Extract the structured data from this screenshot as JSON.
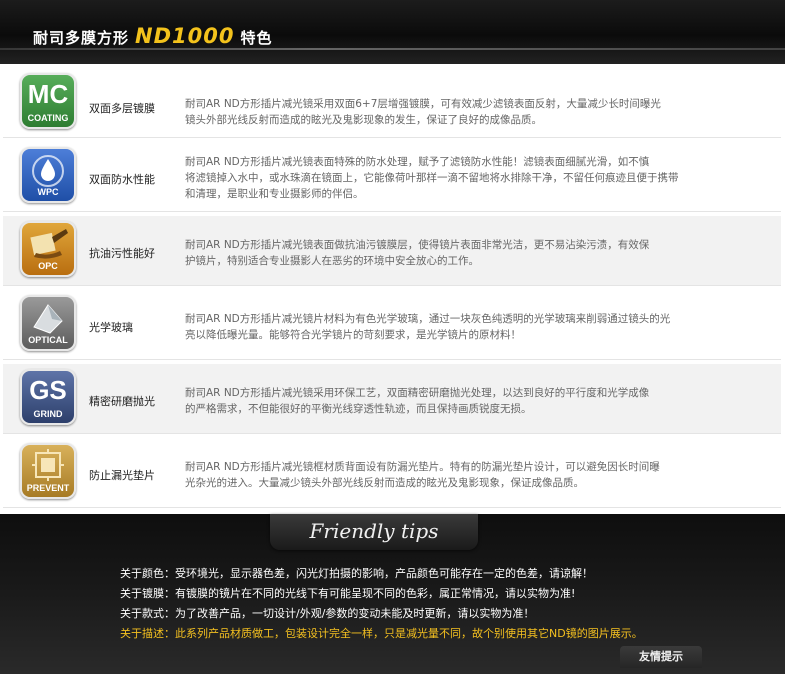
{
  "header": {
    "title_prefix": "耐司多膜方形",
    "title_model": "ND1000",
    "title_suffix": "特色"
  },
  "features": [
    {
      "badge_big": "MC",
      "badge_sub": "COATING",
      "badge_icon": "mc-coating-icon",
      "name": "双面多层镀膜",
      "lines": [
        "耐司AR ND方形插片减光镜采用双面6+7层增强镀膜，可有效减少滤镜表面反射，大量减少长时间曝光",
        "镜头外部光线反射而造成的眩光及鬼影现象的发生，保证了良好的成像品质。"
      ]
    },
    {
      "badge_big": "",
      "badge_sub": "WPC",
      "badge_icon": "water-drop-icon",
      "name": "双面防水性能",
      "lines": [
        "耐司AR ND方形插片减光镜表面特殊的防水处理，赋予了滤镜防水性能！滤镜表面细腻光滑，如不慎",
        "将滤镜掉入水中，或水珠滴在镜面上，它能像荷叶那样一滴不留地将水排除干净，不留任何痕迹且便于携带",
        "和清理，是职业和专业摄影师的伴侣。"
      ]
    },
    {
      "badge_big": "",
      "badge_sub": "OPC",
      "badge_icon": "brush-icon",
      "name": "抗油污性能好",
      "lines": [
        "耐司AR ND方形插片减光镜表面做抗油污镀膜层，使得镜片表面非常光洁，更不易沾染污渍，有效保",
        "护镜片，特别适合专业摄影人在恶劣的环境中安全放心的工作。"
      ]
    },
    {
      "badge_big": "",
      "badge_sub": "OPTICAL",
      "badge_icon": "optical-glass-icon",
      "name": "光学玻璃",
      "lines": [
        "耐司AR ND方形插片减光镜片材料为有色光学玻璃，通过一块灰色纯透明的光学玻璃来削弱通过镜头的光",
        "亮以降低曝光量。能够符合光学镜片的苛刻要求，是光学镜片的原材料！"
      ]
    },
    {
      "badge_big": "GS",
      "badge_sub": "GRIND",
      "badge_icon": "gs-grind-icon",
      "name": "精密研磨抛光",
      "lines": [
        "耐司AR ND方形插片减光镜采用环保工艺，双面精密研磨抛光处理，以达到良好的平行度和光学成像",
        "的严格需求，不但能很好的平衡光线穿透性轨迹，而且保持画质锐度无损。"
      ]
    },
    {
      "badge_big": "",
      "badge_sub": "PREVENT",
      "badge_icon": "prevent-leak-icon",
      "name": "防止漏光垫片",
      "lines": [
        "耐司AR ND方形插片减光镜框材质背面设有防漏光垫片。特有的防漏光垫片设计，可以避免因长时间曝",
        "光杂光的进入。大量减少镜头外部光线反射而造成的眩光及鬼影现象，保证成像品质。"
      ]
    }
  ],
  "tips": {
    "banner": "Friendly tips",
    "items": [
      "关于颜色：受环境光，显示器色差，闪光灯拍摄的影响，产品颜色可能存在一定的色差，请谅解！",
      "关于镀膜：有镀膜的镜片在不同的光线下有可能呈现不同的色彩，属正常情况，请以实物为准!",
      "关于款式：为了改善产品，一切设计/外观/参数的变动未能及时更新，请以实物为准！",
      "关于描述：此系列产品材质做工，包装设计完全一样，只是减光量不同，故个别使用其它ND镜的图片展示。"
    ],
    "friendly_label": "友情提示"
  },
  "colors": {
    "accent_yellow": "#f3c21c",
    "dark_bg": "#111111"
  }
}
